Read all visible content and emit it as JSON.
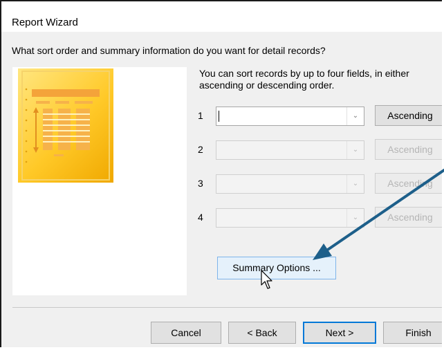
{
  "window": {
    "title": "Report Wizard"
  },
  "question": "What sort order and summary information do you want for detail records?",
  "hint": "You can sort records by up to four fields, in either ascending or descending order.",
  "sort_rows": [
    {
      "number": "1",
      "value": "",
      "order": "Ascending",
      "enabled": true
    },
    {
      "number": "2",
      "value": "",
      "order": "Ascending",
      "enabled": false
    },
    {
      "number": "3",
      "value": "",
      "order": "Ascending",
      "enabled": false
    },
    {
      "number": "4",
      "value": "",
      "order": "Ascending",
      "enabled": false
    }
  ],
  "summary_button": "Summary Options ...",
  "footer": {
    "cancel": "Cancel",
    "back": "< Back",
    "next": "Next >",
    "finish": "Finish"
  },
  "colors": {
    "annotation_arrow": "#1d5f8a",
    "focus_border": "#0078d7",
    "preview_yellow": "#ffc928"
  },
  "icons": {
    "dropdown": "chevron-down-icon",
    "cursor": "mouse-pointer-icon",
    "preview": "report-preview-icon"
  }
}
